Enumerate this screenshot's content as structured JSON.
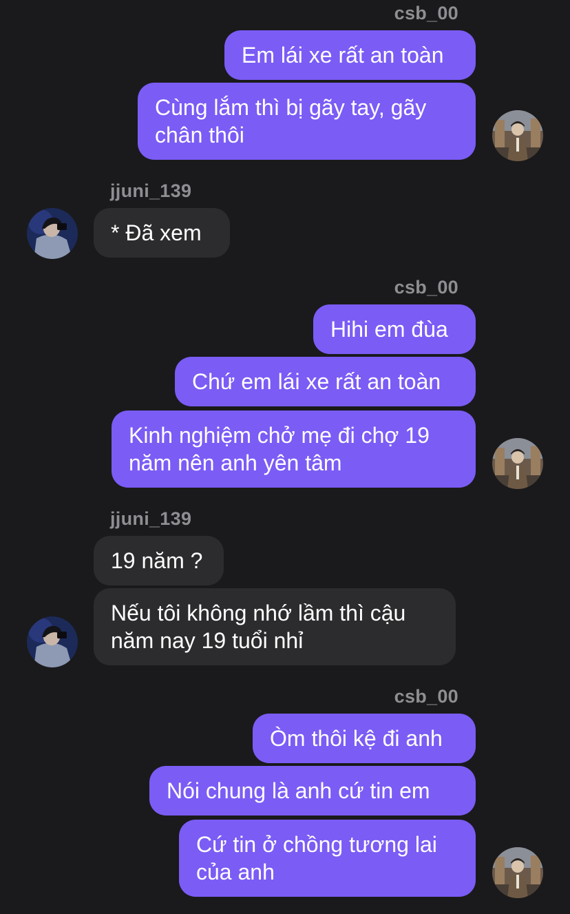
{
  "conversation": {
    "groups": [
      {
        "sender": "csb_00",
        "messages": [
          "Em lái xe rất an toàn",
          "Cùng lắm thì bị gãy tay, gãy chân thôi"
        ]
      },
      {
        "sender": "jjuni_139",
        "messages": [
          "* Đã xem"
        ]
      },
      {
        "sender": "csb_00",
        "messages": [
          "Hihi em đùa",
          "Chứ em lái xe rất an toàn",
          "Kinh nghiệm chở mẹ đi chợ 19 năm nên anh yên tâm"
        ]
      },
      {
        "sender": "jjuni_139",
        "messages": [
          "19 năm ?",
          "Nếu tôi không nhớ lầm thì cậu năm nay 19 tuổi nhỉ"
        ]
      },
      {
        "sender": "csb_00",
        "messages": [
          "Òm thôi kệ đi anh",
          "Nói chung là anh cứ tin em",
          "Cứ tin ở chồng tương lai của anh"
        ]
      }
    ]
  },
  "colors": {
    "background": "#1a1a1c",
    "outgoing_bubble": "#7b5cf5",
    "incoming_bubble": "#2c2c2e",
    "sender_name": "#8e8e93",
    "message_text": "#ffffff"
  },
  "icons": {
    "outgoing_avatar": "user-photo-avatar",
    "incoming_avatar": "user-photo-avatar"
  }
}
